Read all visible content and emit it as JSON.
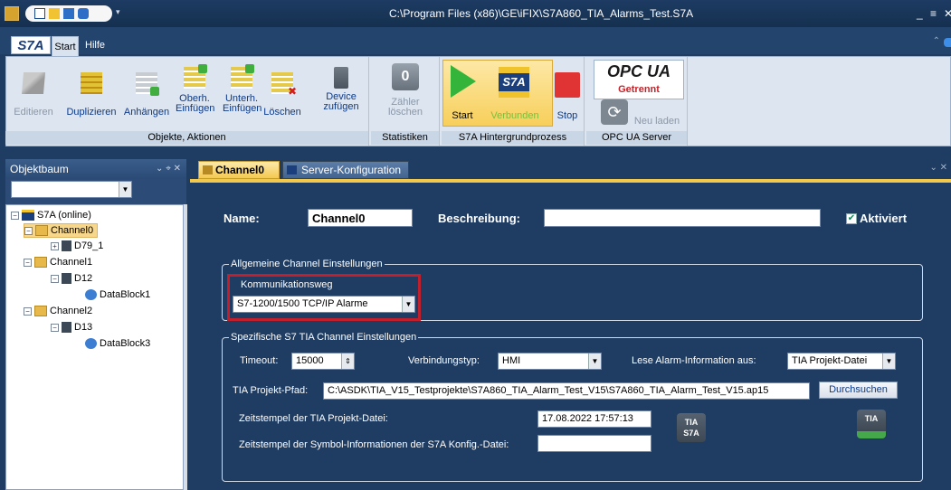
{
  "window": {
    "title": "C:\\Program Files (x86)\\GE\\iFIX\\S7A860_TIA_Alarms_Test.S7A",
    "minimize": "_",
    "maximize": "≡",
    "close": "✕"
  },
  "ribbon": {
    "logo": "S7A",
    "tabs": [
      "Start",
      "Hilfe"
    ],
    "groups": {
      "objects": {
        "label": "Objekte, Aktionen",
        "buttons": [
          "Editieren",
          "Duplizieren",
          "Anhängen",
          "Oberh. Einfügen",
          "Unterh. Einfügen",
          "Löschen",
          "Device zufügen"
        ]
      },
      "stats": {
        "label": "Statistiken",
        "counter": "0",
        "button": "Zähler löschen"
      },
      "bg": {
        "label": "S7A Hintergrundprozess",
        "start": "Start",
        "connected": "Verbunden",
        "stop": "Stop",
        "s7a": "S7A"
      },
      "opc": {
        "label": "OPC UA Server",
        "logo": "OPC UA",
        "status": "Getrennt",
        "reload": "Neu laden"
      }
    }
  },
  "tree_panel": {
    "title": "Objektbaum",
    "items": [
      {
        "label": "S7A (online)"
      },
      {
        "label": "Channel0"
      },
      {
        "label": "D79_1"
      },
      {
        "label": "Channel1"
      },
      {
        "label": "D12"
      },
      {
        "label": "DataBlock1"
      },
      {
        "label": "Channel2"
      },
      {
        "label": "D13"
      },
      {
        "label": "DataBlock3"
      }
    ]
  },
  "doc_tabs": [
    "Channel0",
    "Server-Konfiguration"
  ],
  "form": {
    "name_label": "Name:",
    "name_value": "Channel0",
    "desc_label": "Beschreibung:",
    "desc_value": "",
    "active_label": "Aktiviert",
    "general_group": "Allgemeine Channel Einstellungen",
    "comm_label": "Kommunikationsweg",
    "comm_value": "S7-1200/1500 TCP/IP Alarme",
    "tia_group": "Spezifische S7 TIA Channel Einstellungen",
    "timeout_label": "Timeout:",
    "timeout_value": "15000",
    "conn_type_label": "Verbindungstyp:",
    "conn_type_value": "HMI",
    "alarm_source_label": "Lese Alarm-Information aus:",
    "alarm_source_value": "TIA Projekt-Datei",
    "path_label": "TIA Projekt-Pfad:",
    "path_value": "C:\\ASDK\\TIA_V15_Testprojekte\\S7A860_TIA_Alarm_Test_V15\\S7A860_TIA_Alarm_Test_V15.ap15",
    "browse_label": "Durchsuchen",
    "timestamp_label": "Zeitstempel der TIA Projekt-Datei:",
    "timestamp_value": "17.08.2022 17:57:13",
    "symbol_ts_label": "Zeitstempel der Symbol-Informationen der S7A Konfig.-Datei:",
    "symbol_ts_value": "",
    "tia_icon1": "TIA S7A",
    "tia_icon2": "TIA"
  }
}
